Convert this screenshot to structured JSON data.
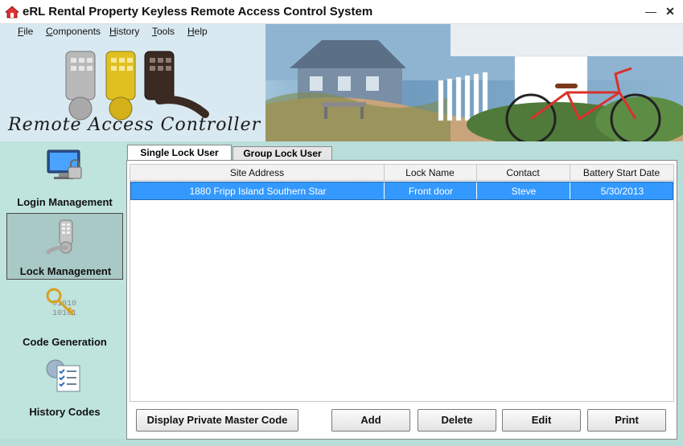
{
  "window": {
    "title": "eRL Rental Property Keyless Remote Access Control System",
    "minimize": "—",
    "close": "✕"
  },
  "menu": {
    "file": {
      "u": "F",
      "rest": "ile"
    },
    "components": {
      "u": "C",
      "rest": "omponents"
    },
    "history": {
      "u": "H",
      "rest": "istory"
    },
    "tools": {
      "u": "T",
      "rest": "ools"
    },
    "help": {
      "u": "H",
      "rest": "elp"
    }
  },
  "banner": {
    "caption": "Remote Access Controller"
  },
  "sidebar": {
    "items": [
      {
        "label": "Login Management",
        "icon": "monitor-lock-icon",
        "active": false
      },
      {
        "label": "Lock Management",
        "icon": "keypad-lock-icon",
        "active": true
      },
      {
        "label": "Code Generation",
        "icon": "binary-key-icon",
        "active": false
      },
      {
        "label": "History Codes",
        "icon": "checklist-icon",
        "active": false
      }
    ]
  },
  "tabs": [
    {
      "label": "Single Lock User",
      "active": true
    },
    {
      "label": "Group Lock User",
      "active": false
    }
  ],
  "table": {
    "columns": [
      "Site Address",
      "Lock Name",
      "Contact",
      "Battery Start Date"
    ],
    "rows": [
      {
        "site_address": "1880 Fripp Island Southern Star",
        "lock_name": "Front door",
        "contact": "Steve",
        "battery_start_date": "5/30/2013",
        "selected": true
      }
    ]
  },
  "buttons": {
    "master": "Display Private Master Code",
    "add": "Add",
    "delete": "Delete",
    "edit": "Edit",
    "print": "Print"
  },
  "colors": {
    "selection": "#3399ff",
    "background": "#b9ded9"
  }
}
